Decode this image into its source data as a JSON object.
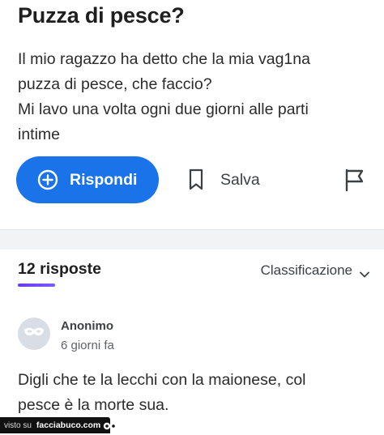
{
  "question": {
    "title": "Puzza di pesce?",
    "body_lines": [
      "Il mio ragazzo ha detto che la mia vag1na",
      "puzza di pesce, che faccio?",
      "Mi lavo una volta ogni due giorni alle parti",
      "intime"
    ],
    "actions": {
      "reply_label": "Rispondi",
      "reply_icon": "plus-circle-icon",
      "save_label": "Salva",
      "save_icon": "bookmark-icon",
      "report_icon": "flag-icon"
    }
  },
  "answers": {
    "count_label": "12 risposte",
    "sort_label": "Classificazione",
    "sort_icon": "chevron-down-icon",
    "items": [
      {
        "author": "Anonimo",
        "avatar_icon": "anonymous-mask-icon",
        "time": "6 giorni fa",
        "text_lines": [
          "Digli che te la lecchi con la maionese, col",
          "pesce è la morte sua."
        ]
      }
    ]
  },
  "watermark": {
    "prefix": "visto su",
    "site": "facciabuco.com"
  },
  "colors": {
    "accent": "#1a73e8",
    "underline": "#6a3df0",
    "separator": "#f1f3f4",
    "avatar_bg": "#d9dee6"
  }
}
